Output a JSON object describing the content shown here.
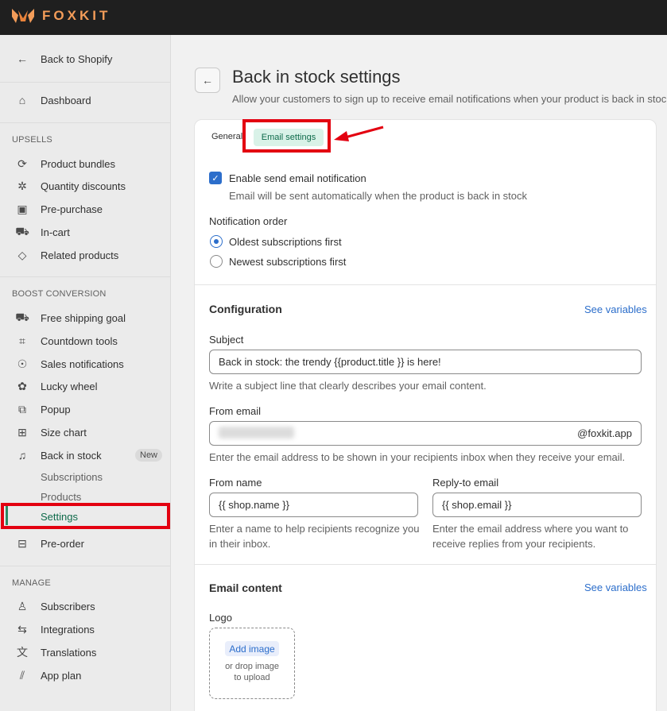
{
  "brand": {
    "name": "FOXKIT",
    "accent": "#f39c59"
  },
  "sidebar": {
    "back": "Back to Shopify",
    "dashboard": "Dashboard",
    "upsells_header": "UPSELLS",
    "upsells": [
      "Product bundles",
      "Quantity discounts",
      "Pre-purchase",
      "In-cart",
      "Related products"
    ],
    "boost_header": "BOOST CONVERSION",
    "boost": [
      "Free shipping goal",
      "Countdown tools",
      "Sales notifications",
      "Lucky wheel",
      "Popup",
      "Size chart",
      "Back in stock"
    ],
    "new_badge": "New",
    "back_in_stock_sub": [
      "Subscriptions",
      "Products",
      "Settings"
    ],
    "preorder": "Pre-order",
    "manage_header": "MANAGE",
    "manage": [
      "Subscribers",
      "Integrations",
      "Translations",
      "App plan"
    ]
  },
  "page": {
    "title": "Back in stock settings",
    "subtitle": "Allow your customers to sign up to receive email notifications when your product is back in stock."
  },
  "tabs": {
    "general": "General",
    "email": "Email settings"
  },
  "notification": {
    "enable_label": "Enable send email notification",
    "enable_help": "Email will be sent automatically when the product is back in stock",
    "order_label": "Notification order",
    "oldest": "Oldest subscriptions first",
    "newest": "Newest subscriptions first"
  },
  "configuration": {
    "title": "Configuration",
    "see_variables": "See variables",
    "subject_label": "Subject",
    "subject_value": "Back in stock: the trendy {{product.title }} is here!",
    "subject_help": "Write a subject line that clearly describes your email content.",
    "from_email_label": "From email",
    "from_email_suffix": "@foxkit.app",
    "from_email_help": "Enter the email address to be shown in your recipients inbox when they receive your email.",
    "from_name_label": "From name",
    "from_name_value": "{{ shop.name }}",
    "from_name_help_1": "Enter a name to help recipients recognize you",
    "from_name_help_2": "in their inbox.",
    "reply_label": "Reply-to email",
    "reply_value": "{{ shop.email }}",
    "reply_help_1": "Enter the email address where you want to",
    "reply_help_2": "receive replies from your recipients."
  },
  "email_content": {
    "title": "Email content",
    "see_variables": "See variables",
    "logo_label": "Logo",
    "add_image": "Add image",
    "drop_1": "or drop image",
    "drop_2": "to upload"
  }
}
